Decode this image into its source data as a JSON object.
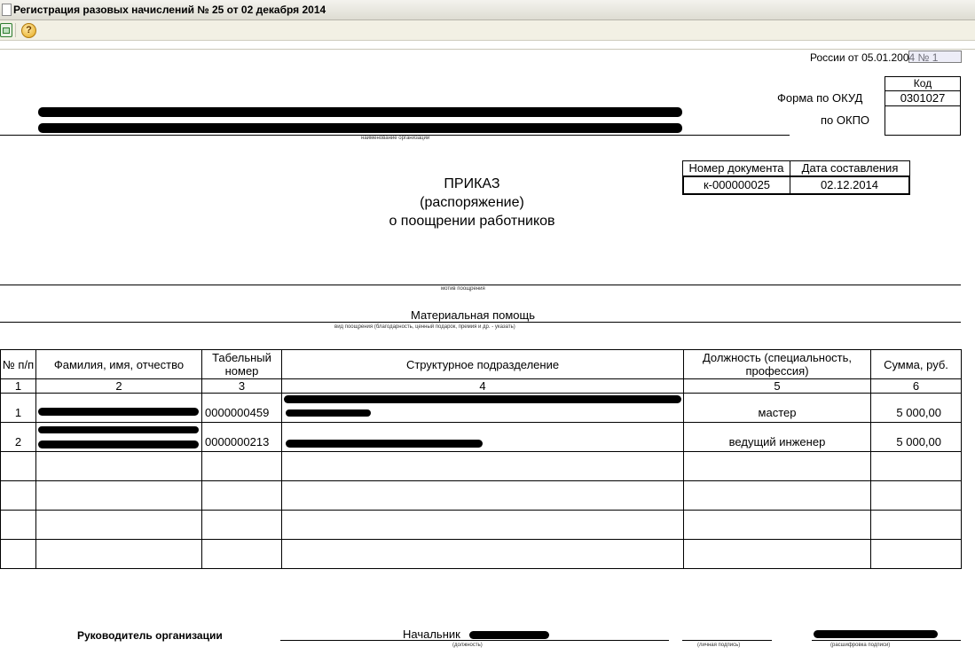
{
  "window": {
    "title": "Регистрация разовых начислений № 25 от 02 декабря 2014"
  },
  "toolbar": {
    "print_icon": "print-icon",
    "help_label": "?"
  },
  "form": {
    "top_note": "России от 05.01.2004 № 1",
    "code_header": "Код",
    "okud_label": "Форма по ОКУД",
    "okud_value": "0301027",
    "okpo_label": "по ОКПО",
    "okpo_value": "",
    "org_caption": "наименование организации",
    "doc_number_header": "Номер документа",
    "doc_date_header": "Дата составления",
    "doc_number": "к-000000025",
    "doc_date": "02.12.2014",
    "title_line1": "ПРИКАЗ",
    "title_line2": "(распоряжение)",
    "title_line3": "о поощрении работников",
    "motive_caption": "мотив поощрения",
    "reward_type": "Материальная помощь",
    "reward_caption": "вид поощрения (благодарность, ценный подарок, премия и др. - указать)"
  },
  "table": {
    "headers": [
      "№ п/п",
      "Фамилия, имя, отчество",
      "Табельный номер",
      "Структурное подразделение",
      "Должность (специальность, профессия)",
      "Сумма, руб."
    ],
    "numbers": [
      "1",
      "2",
      "3",
      "4",
      "5",
      "6"
    ],
    "rows": [
      {
        "num": "1",
        "name": "",
        "tab": "0000000459",
        "dept": "",
        "position": "мастер",
        "sum": "5 000,00"
      },
      {
        "num": "2",
        "name": "",
        "tab": "0000000213",
        "dept": "",
        "position": "ведущий инженер",
        "sum": "5 000,00"
      }
    ]
  },
  "footer": {
    "head_label": "Руководитель организации",
    "position_value": "Начальник",
    "position_caption": "(должность)",
    "signature_caption": "(личная подпись)",
    "decoding_caption": "(расшифровка подписи)"
  }
}
